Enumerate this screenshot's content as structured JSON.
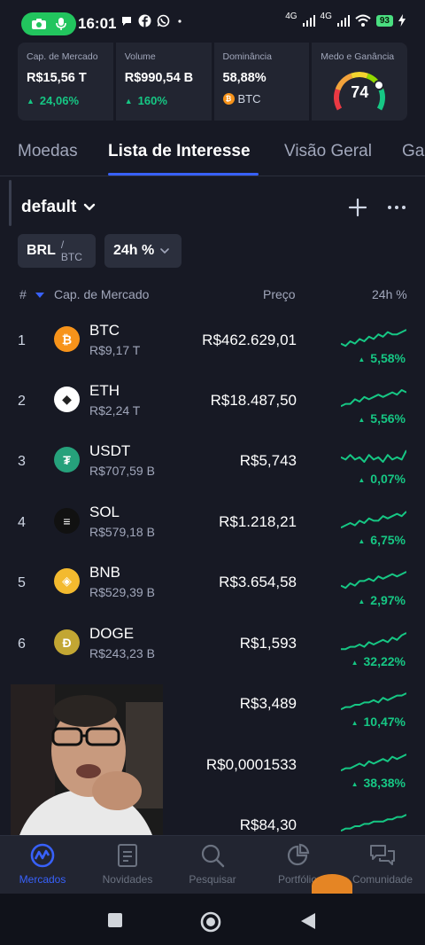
{
  "status_bar": {
    "time": "16:01",
    "network_1": "4G",
    "network_2": "4G",
    "battery": "93"
  },
  "stats": {
    "market_cap": {
      "label": "Cap. de Mercado",
      "value": "R$15,56 T",
      "change": "24,06%"
    },
    "volume": {
      "label": "Volume",
      "value": "R$990,54 B",
      "change": "160%"
    },
    "dominance": {
      "label": "Dominância",
      "value": "58,88%",
      "coin": "BTC"
    },
    "fear_greed": {
      "label": "Medo e Ganância",
      "value": "74",
      "level": 0.74
    }
  },
  "tabs": [
    {
      "label": "Moedas"
    },
    {
      "label": "Lista de Interesse"
    },
    {
      "label": "Visão Geral"
    },
    {
      "label": "Ga"
    }
  ],
  "list": {
    "name": "default",
    "currency_primary": "BRL",
    "currency_secondary": "/ BTC",
    "timeframe": "24h %"
  },
  "columns": {
    "rank": "#",
    "market_cap": "Cap. de Mercado",
    "price": "Preço",
    "change": "24h %"
  },
  "coins": [
    {
      "rank": "1",
      "symbol": "BTC",
      "mcap": "R$9,17 T",
      "price": "R$462.629,01",
      "change": "5,58%",
      "color": "#f7931a",
      "icon": "bitcoin-icon",
      "glyph": "₿"
    },
    {
      "rank": "2",
      "symbol": "ETH",
      "mcap": "R$2,24 T",
      "price": "R$18.487,50",
      "change": "5,56%",
      "color": "#ffffff",
      "icon": "ethereum-icon",
      "glyph": "◆"
    },
    {
      "rank": "3",
      "symbol": "USDT",
      "mcap": "R$707,59 B",
      "price": "R$5,743",
      "change": "0,07%",
      "color": "#26a17b",
      "icon": "tether-icon",
      "glyph": "₮"
    },
    {
      "rank": "4",
      "symbol": "SOL",
      "mcap": "R$579,18 B",
      "price": "R$1.218,21",
      "change": "6,75%",
      "color": "#111111",
      "icon": "solana-icon",
      "glyph": "≡"
    },
    {
      "rank": "5",
      "symbol": "BNB",
      "mcap": "R$529,39 B",
      "price": "R$3.654,58",
      "change": "2,97%",
      "color": "#f3ba2f",
      "icon": "bnb-icon",
      "glyph": "◈"
    },
    {
      "rank": "6",
      "symbol": "DOGE",
      "mcap": "R$243,23 B",
      "price": "R$1,593",
      "change": "32,22%",
      "color": "#c2a633",
      "icon": "dogecoin-icon",
      "glyph": "Ð"
    },
    {
      "rank": "",
      "symbol": "",
      "mcap": "",
      "price": "R$3,489",
      "change": "10,47%",
      "color": "",
      "icon": "",
      "glyph": ""
    },
    {
      "rank": "",
      "symbol": "",
      "mcap": "",
      "price": "R$0,0001533",
      "change": "38,38%",
      "color": "",
      "icon": "",
      "glyph": ""
    },
    {
      "rank": "",
      "symbol": "",
      "mcap": "",
      "price": "R$84,30",
      "change": "",
      "color": "",
      "icon": "",
      "glyph": ""
    }
  ],
  "bottom_nav": [
    {
      "label": "Mercados",
      "icon": "markets-icon"
    },
    {
      "label": "Novidades",
      "icon": "news-icon"
    },
    {
      "label": "Pesquisar",
      "icon": "search-icon"
    },
    {
      "label": "Portfólio",
      "icon": "portfolio-icon"
    },
    {
      "label": "Comunidade",
      "icon": "community-icon"
    }
  ],
  "colors": {
    "background": "#171924",
    "card": "#222531",
    "positive": "#16c784",
    "accent": "#3861fb"
  }
}
